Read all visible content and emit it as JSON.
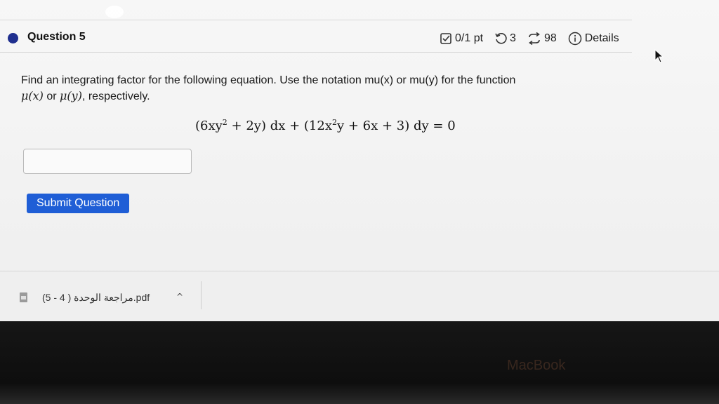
{
  "question": {
    "title": "Question 5",
    "score": "0/1 pt",
    "attempts": "3",
    "retries": "98",
    "details": "Details"
  },
  "prompt": {
    "line1": "Find an integrating factor for the following equation. Use the notation mu(x) or mu(y) for the function",
    "mu_x": "μ(x)",
    "or": " or ",
    "mu_y": "μ(y)",
    "line2_end": ", respectively."
  },
  "equation": {
    "p1": "(6xy",
    "sup1": "2",
    "p2": " + 2y) dx + (12x",
    "sup2": "2",
    "p3": "y + 6x + 3) dy = 0"
  },
  "answer": {
    "value": "",
    "placeholder": ""
  },
  "submit": {
    "label": "Submit Question"
  },
  "downloads": {
    "file_name": "(5 - 4 ) مراجعة الوحدة.pdf"
  },
  "device": {
    "brand": "MacBook"
  },
  "colors": {
    "accent": "#1f5ed6",
    "question_dot": "#1f2f8f"
  },
  "icons": [
    "checkbox-icon",
    "refresh-icon",
    "retry-icon",
    "info-icon",
    "pdf-file-icon",
    "chevron-up-icon",
    "mouse-cursor-icon"
  ]
}
